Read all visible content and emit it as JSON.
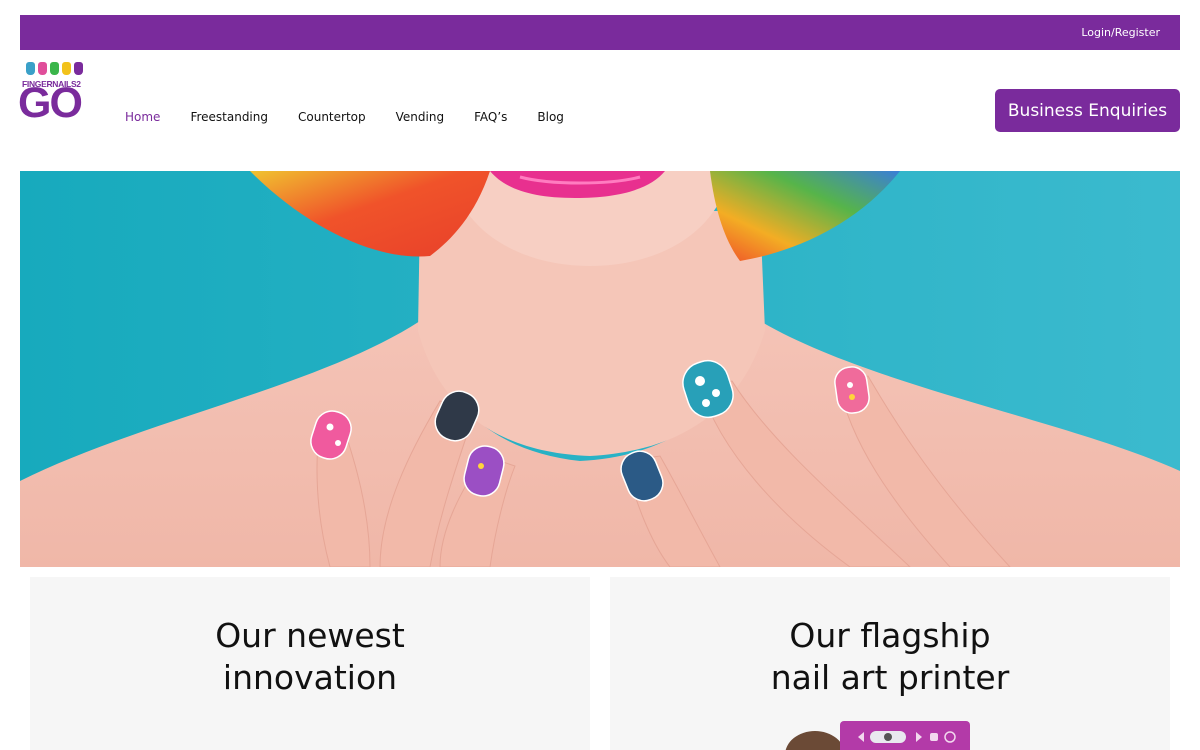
{
  "topbar": {
    "login_label": "Login/Register"
  },
  "logo": {
    "brand_small": "FINGERNAILS2",
    "brand_big": "GO"
  },
  "nav": {
    "items": [
      {
        "label": "Home",
        "active": true
      },
      {
        "label": "Freestanding"
      },
      {
        "label": "Countertop"
      },
      {
        "label": "Vending"
      },
      {
        "label": "FAQ’s"
      },
      {
        "label": "Blog"
      }
    ]
  },
  "cta": {
    "label": "Business Enquiries"
  },
  "colors": {
    "brand": "#7a2b9c",
    "hero_bg": "#2fb3c6",
    "lips": "#e8308f"
  },
  "cards": [
    {
      "title_line1": "Our newest",
      "title_line2": "innovation"
    },
    {
      "title_line1": "Our flagship",
      "title_line2": "nail art printer"
    }
  ]
}
